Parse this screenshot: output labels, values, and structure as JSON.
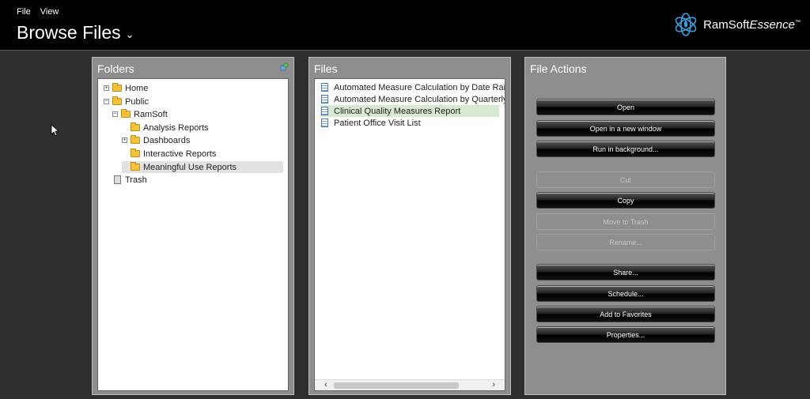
{
  "menu": {
    "file": "File",
    "view": "View"
  },
  "header": {
    "title": "Browse Files",
    "brand_main": "RamSoft",
    "brand_italic": "Essence",
    "brand_tm": "™"
  },
  "folders": {
    "title": "Folders",
    "items": [
      {
        "label": "Home",
        "expander": "+"
      },
      {
        "label": "Public",
        "expander": "−"
      },
      {
        "label": "RamSoft",
        "expander": "−"
      },
      {
        "label": "Analysis Reports"
      },
      {
        "label": "Dashboards",
        "expander": "+"
      },
      {
        "label": "Interactive Reports"
      },
      {
        "label": "Meaningful Use Reports",
        "selected": true
      },
      {
        "label": "Trash"
      }
    ]
  },
  "files": {
    "title": "Files",
    "items": [
      {
        "label": "Automated Measure Calculation by Date Range"
      },
      {
        "label": "Automated Measure Calculation by Quarterly Range"
      },
      {
        "label": "Clinical Quality Measures Report",
        "selected": true
      },
      {
        "label": "Patient Office Visit List"
      }
    ]
  },
  "actions": {
    "title": "File Actions",
    "buttons": [
      {
        "label": "Open",
        "enabled": true
      },
      {
        "label": "Open in a new window",
        "enabled": true
      },
      {
        "label": "Run in background...",
        "enabled": true
      },
      {
        "label": "Cut",
        "enabled": false
      },
      {
        "label": "Copy",
        "enabled": true
      },
      {
        "label": "Move to Trash",
        "enabled": false
      },
      {
        "label": "Rename...",
        "enabled": false
      },
      {
        "label": "Share...",
        "enabled": true
      },
      {
        "label": "Schedule...",
        "enabled": true
      },
      {
        "label": "Add to Favorites",
        "enabled": true
      },
      {
        "label": "Properties...",
        "enabled": true
      }
    ]
  },
  "colors": {
    "topbar": "#000000",
    "background": "#2f2f2f",
    "panel": "#8e8e8e",
    "selected_file": "#d7ead1",
    "selected_folder": "#e2e2e2",
    "folder_icon": "#f3c23a"
  }
}
